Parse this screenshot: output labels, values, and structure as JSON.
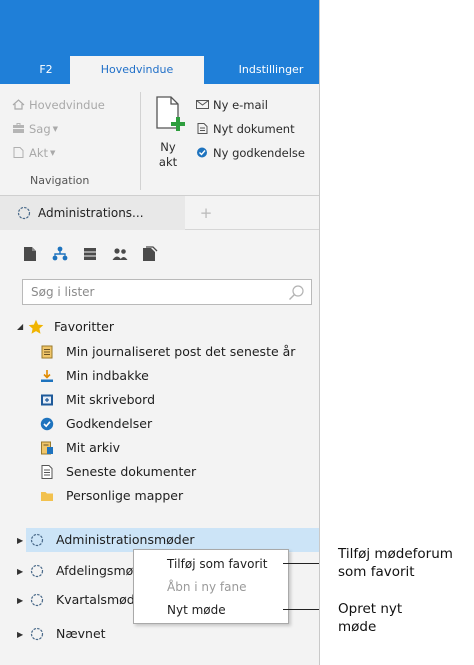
{
  "ribbon_tabs": {
    "f2": "F2",
    "main": "Hovedvindue",
    "settings": "Indstillinger"
  },
  "ribbon": {
    "nav_main": "Hovedvindue",
    "nav_case": "Sag",
    "nav_doc": "Akt",
    "group_label": "Navigation",
    "new_act_line1": "Ny",
    "new_act_line2": "akt",
    "new_email": "Ny e-mail",
    "new_document": "Nyt dokument",
    "new_approval": "Ny godkendelse"
  },
  "pane_tab": {
    "label": "Administrations...",
    "add": "+"
  },
  "search": {
    "placeholder": "Søg i lister"
  },
  "tree": {
    "favorites_label": "Favoritter",
    "favorites": [
      "Min journaliseret post det seneste år",
      "Min indbakke",
      "Mit skrivebord",
      "Godkendelser",
      "Mit arkiv",
      "Seneste dokumenter",
      "Personlige mapper"
    ],
    "nodes": [
      "Administrationsmøder",
      "Afdelingsmøder",
      "Kvartalsmøder",
      "Nævnet"
    ]
  },
  "context_menu": {
    "add_favorite": "Tilføj som favorit",
    "open_new_tab": "Åbn i ny fane",
    "new_meeting": "Nyt møde"
  },
  "annotations": {
    "add_forum_line1": "Tilføj mødeforum",
    "add_forum_line2": "som favorit",
    "new_meeting_line1": "Opret nyt",
    "new_meeting_line2": "møde"
  },
  "colors": {
    "header_blue": "#1f7fd8",
    "selection": "#cce4f7",
    "star": "#f0b400",
    "approval_blue": "#1e73be"
  }
}
